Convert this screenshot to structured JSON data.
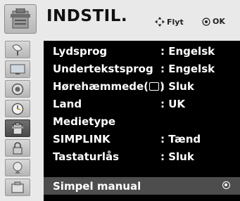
{
  "header": {
    "title": "INDSTIL.",
    "move_hint": "Flyt",
    "ok_hint": "OK",
    "icon": "settings-icon"
  },
  "sidebar": {
    "items": [
      {
        "icon": "satellite-dish-icon",
        "active": false
      },
      {
        "icon": "picture-icon",
        "active": false
      },
      {
        "icon": "audio-icon",
        "active": false
      },
      {
        "icon": "clock-icon",
        "active": false
      },
      {
        "icon": "settings-icon",
        "active": true
      },
      {
        "icon": "lock-icon",
        "active": false
      },
      {
        "icon": "input-icon",
        "active": false
      },
      {
        "icon": "usb-icon",
        "active": false
      }
    ]
  },
  "menu": {
    "rows": [
      {
        "label": "Lydsprog",
        "value": ": Engelsk"
      },
      {
        "label": "Undertekstsprog",
        "value": ": Engelsk"
      },
      {
        "label_prefix": "Hørehæmmede(",
        "label_suffix": ")",
        "value": ": Sluk"
      },
      {
        "label": "Land",
        "value": ": UK"
      },
      {
        "label": "Medietype",
        "value": ""
      },
      {
        "label": "SIMPLINK",
        "value": ": Tænd"
      },
      {
        "label": "Tastaturlås",
        "value": ": Sluk"
      },
      {
        "label": "Simpel manual",
        "value": "",
        "selected": true
      }
    ]
  },
  "colors": {
    "list_bg": "#000000",
    "selected_bg": "#4d4d4d",
    "panel_bg": "#e9e9e9"
  }
}
